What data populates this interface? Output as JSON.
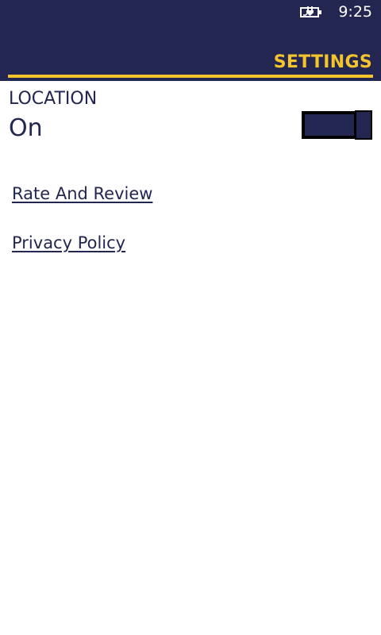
{
  "status_bar": {
    "time": "9:25",
    "battery_icon": "battery-charging-icon"
  },
  "header": {
    "title": "SETTINGS"
  },
  "location": {
    "label": "LOCATION",
    "state": "On",
    "toggle_on": true
  },
  "links": {
    "rate_and_review": "Rate And Review",
    "privacy_policy": "Privacy Policy"
  },
  "colors": {
    "header_background": "#232650",
    "accent": "#f4c42d",
    "text": "#232650",
    "background": "#ffffff"
  }
}
